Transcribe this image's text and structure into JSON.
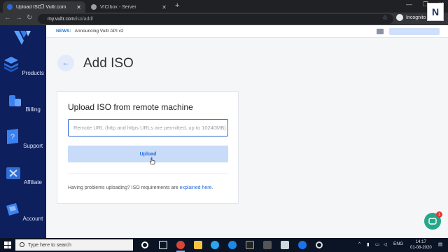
{
  "browser": {
    "tabs": [
      {
        "title": "Upload ISO - Vultr.com",
        "active": true
      },
      {
        "title": "VICIbox - Server",
        "active": false
      }
    ],
    "url_host": "my.vultr.com",
    "url_path": "/iso/add/",
    "profile_label": "Incognito"
  },
  "sidebar": {
    "items": [
      {
        "label": "Products",
        "icon": "layers-icon"
      },
      {
        "label": "Billing",
        "icon": "coins-icon"
      },
      {
        "label": "Support",
        "icon": "question-book-icon"
      },
      {
        "label": "Affiliate",
        "icon": "share-icon"
      },
      {
        "label": "Account",
        "icon": "account-card-icon"
      }
    ]
  },
  "newsbar": {
    "label": "NEWS:",
    "text": "Announcing Vultr API v2"
  },
  "page": {
    "title": "Add ISO"
  },
  "upload_card": {
    "title": "Upload ISO from remote machine",
    "input_placeholder": "Remote URL (http and https URLs are permitted, up to 10240MB)",
    "button_label": "Upload",
    "help_text": "Having problems uploading? ISO requirements are",
    "help_link": "explained here",
    "help_end": "."
  },
  "chat": {
    "badge": "1"
  },
  "taskbar": {
    "search_placeholder": "Type here to search",
    "lang": "ENG",
    "time": "14:17",
    "date": "01-08-2020"
  },
  "colors": {
    "sidebar": "#0d1f5c",
    "accent": "#2b6bd6",
    "button_bg": "#c8dbf8",
    "chat": "#26a78a"
  }
}
